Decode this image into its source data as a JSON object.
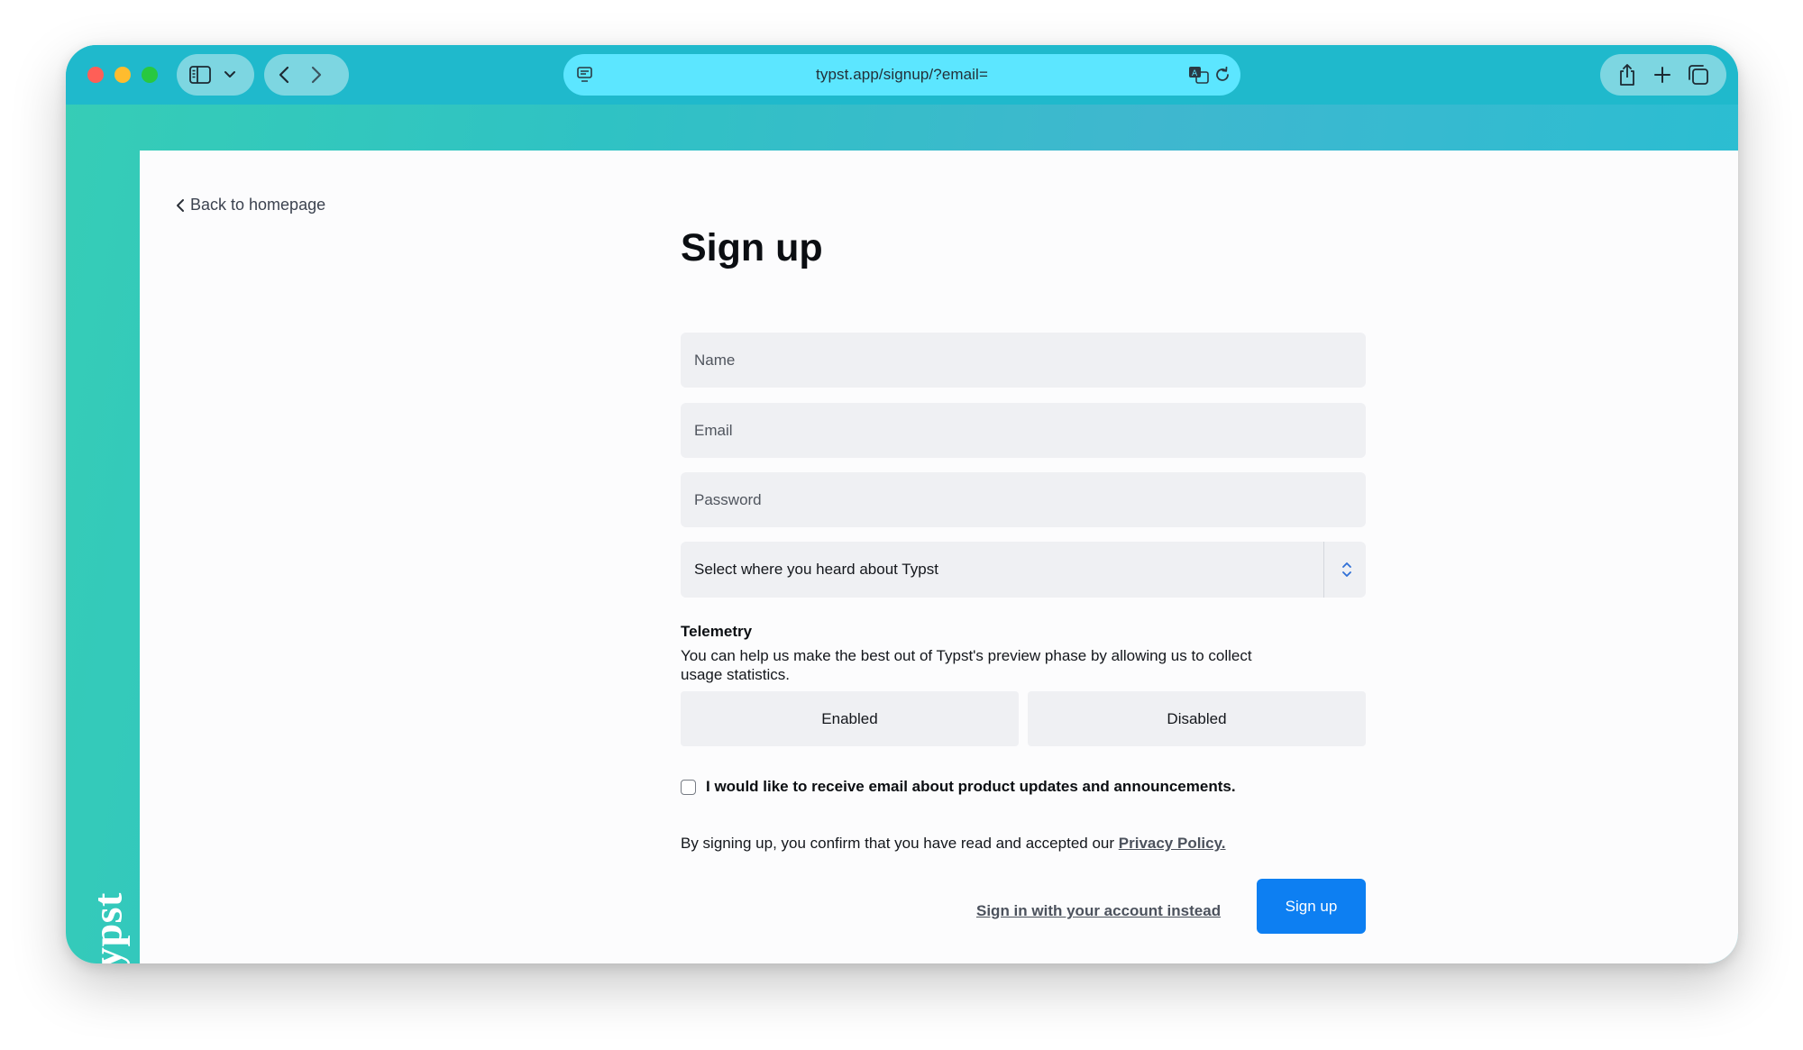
{
  "browser": {
    "url": "typst.app/signup/?email=",
    "icons": [
      "sidebar-icon",
      "chevron-down-icon",
      "back-arrow-icon",
      "forward-arrow-icon",
      "page-icon",
      "translate-icon",
      "reload-icon",
      "share-icon",
      "new-tab-icon",
      "tabs-overview-icon"
    ]
  },
  "brand": {
    "logo_text": "typst",
    "accent_color": "#0d7ff2"
  },
  "page": {
    "back_link": "Back to homepage",
    "title": "Sign up",
    "fields": {
      "name_placeholder": "Name",
      "email_placeholder": "Email",
      "password_placeholder": "Password"
    },
    "referral_select": {
      "value": "Select where you heard about Typst"
    },
    "telemetry": {
      "heading": "Telemetry",
      "description": "You can help us make the best out of Typst's preview phase by allowing us to collect usage statistics.",
      "options": [
        "Enabled",
        "Disabled"
      ]
    },
    "newsletter_label": "I would like to receive email about product updates and announcements.",
    "consent_text": "By signing up, you confirm that you have read and accepted our",
    "privacy_link": "Privacy Policy.",
    "signin_link": "Sign in with your account instead",
    "submit_label": "Sign up"
  }
}
